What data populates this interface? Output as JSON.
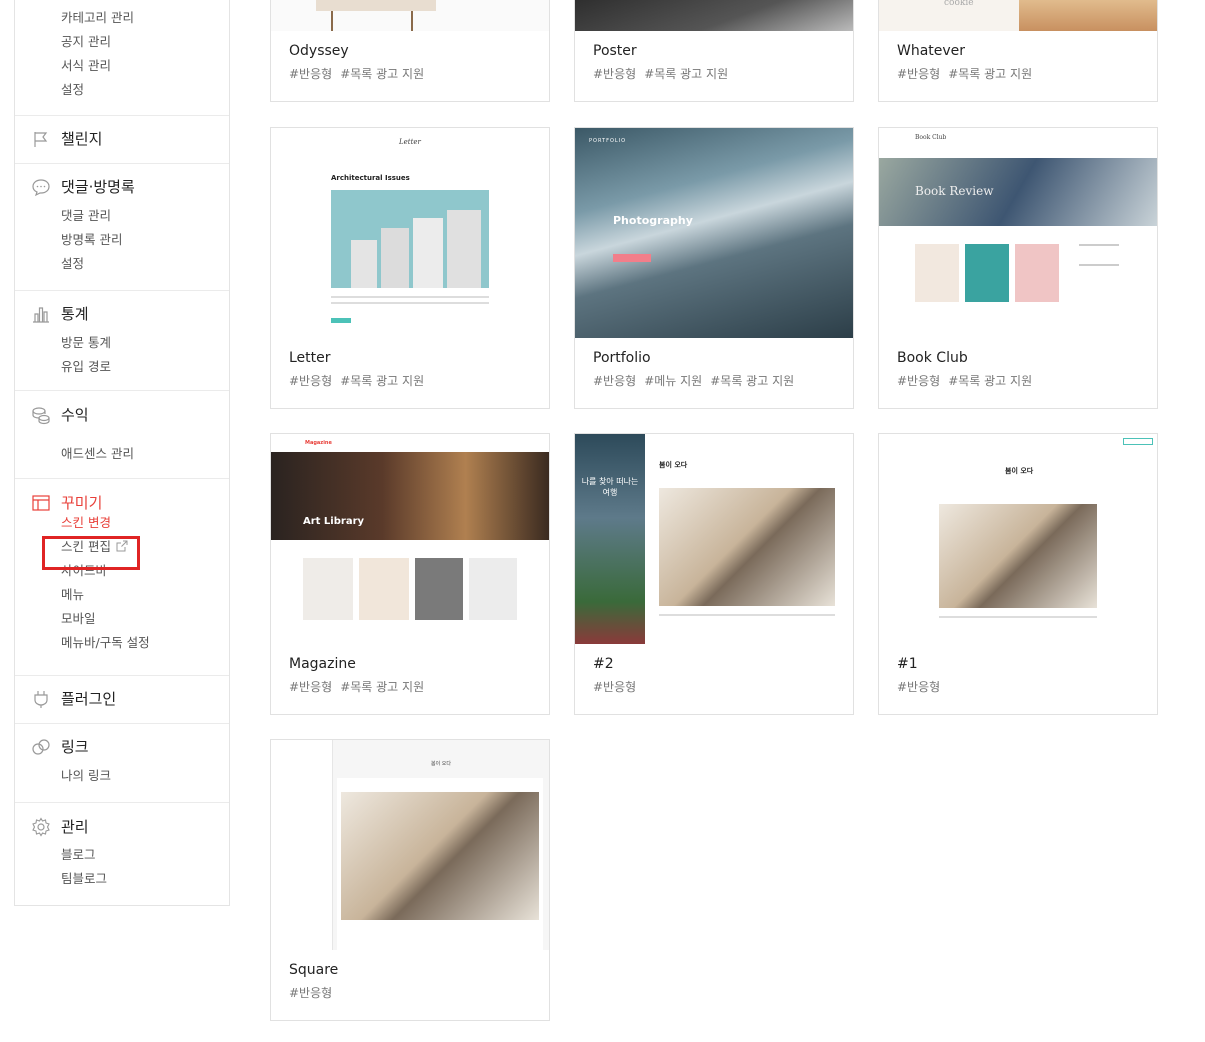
{
  "sidebar": {
    "top_items": [
      "카테고리 관리",
      "공지 관리",
      "서식 관리",
      "설정"
    ],
    "challenge": {
      "title": "챌린지"
    },
    "comments": {
      "title": "댓글·방명록",
      "items": [
        "댓글 관리",
        "방명록 관리",
        "설정"
      ]
    },
    "stats": {
      "title": "통계",
      "items": [
        "방문 통계",
        "유입 경로"
      ]
    },
    "revenue": {
      "title": "수익",
      "items": [
        "애드센스 관리"
      ]
    },
    "decorate": {
      "title": "꾸미기",
      "items": [
        "스킨 변경",
        "스킨 편집",
        "사이드바",
        "메뉴",
        "모바일",
        "메뉴바/구독 설정"
      ]
    },
    "plugin": {
      "title": "플러그인"
    },
    "link": {
      "title": "링크",
      "items": [
        "나의 링크"
      ]
    },
    "manage": {
      "title": "관리",
      "items": [
        "블로그",
        "팀블로그"
      ]
    }
  },
  "skins": [
    {
      "name": "Odyssey",
      "tags": [
        "#반응형",
        "#목록 광고 지원"
      ]
    },
    {
      "name": "Poster",
      "tags": [
        "#반응형",
        "#목록 광고 지원"
      ]
    },
    {
      "name": "Whatever",
      "tags": [
        "#반응형",
        "#목록 광고 지원"
      ],
      "thumb_text": "cookie"
    },
    {
      "name": "Letter",
      "tags": [
        "#반응형",
        "#목록 광고 지원"
      ],
      "thumb_text": "Architectural Issues",
      "thumb_logo": "Letter"
    },
    {
      "name": "Portfolio",
      "tags": [
        "#반응형",
        "#메뉴 지원",
        "#목록 광고 지원"
      ],
      "thumb_text": "Photography",
      "thumb_logo": "PORTFOLIO"
    },
    {
      "name": "Book Club",
      "tags": [
        "#반응형",
        "#목록 광고 지원"
      ],
      "thumb_text": "Book Review",
      "thumb_logo": "Book Club"
    },
    {
      "name": "Magazine",
      "tags": [
        "#반응형",
        "#목록 광고 지원"
      ],
      "thumb_text": "Art Library",
      "thumb_logo": "Magazine"
    },
    {
      "name": "#2",
      "tags": [
        "#반응형"
      ],
      "thumb_text": "봄이 오다",
      "thumb_side": "나를 찾아 떠나는 여행"
    },
    {
      "name": "#1",
      "tags": [
        "#반응형"
      ],
      "thumb_text": "봄이 오다"
    },
    {
      "name": "Square",
      "tags": [
        "#반응형"
      ],
      "thumb_text": "봄이 오다"
    }
  ],
  "colors": {
    "accent": "#e8403a",
    "highlight": "#e02424"
  }
}
